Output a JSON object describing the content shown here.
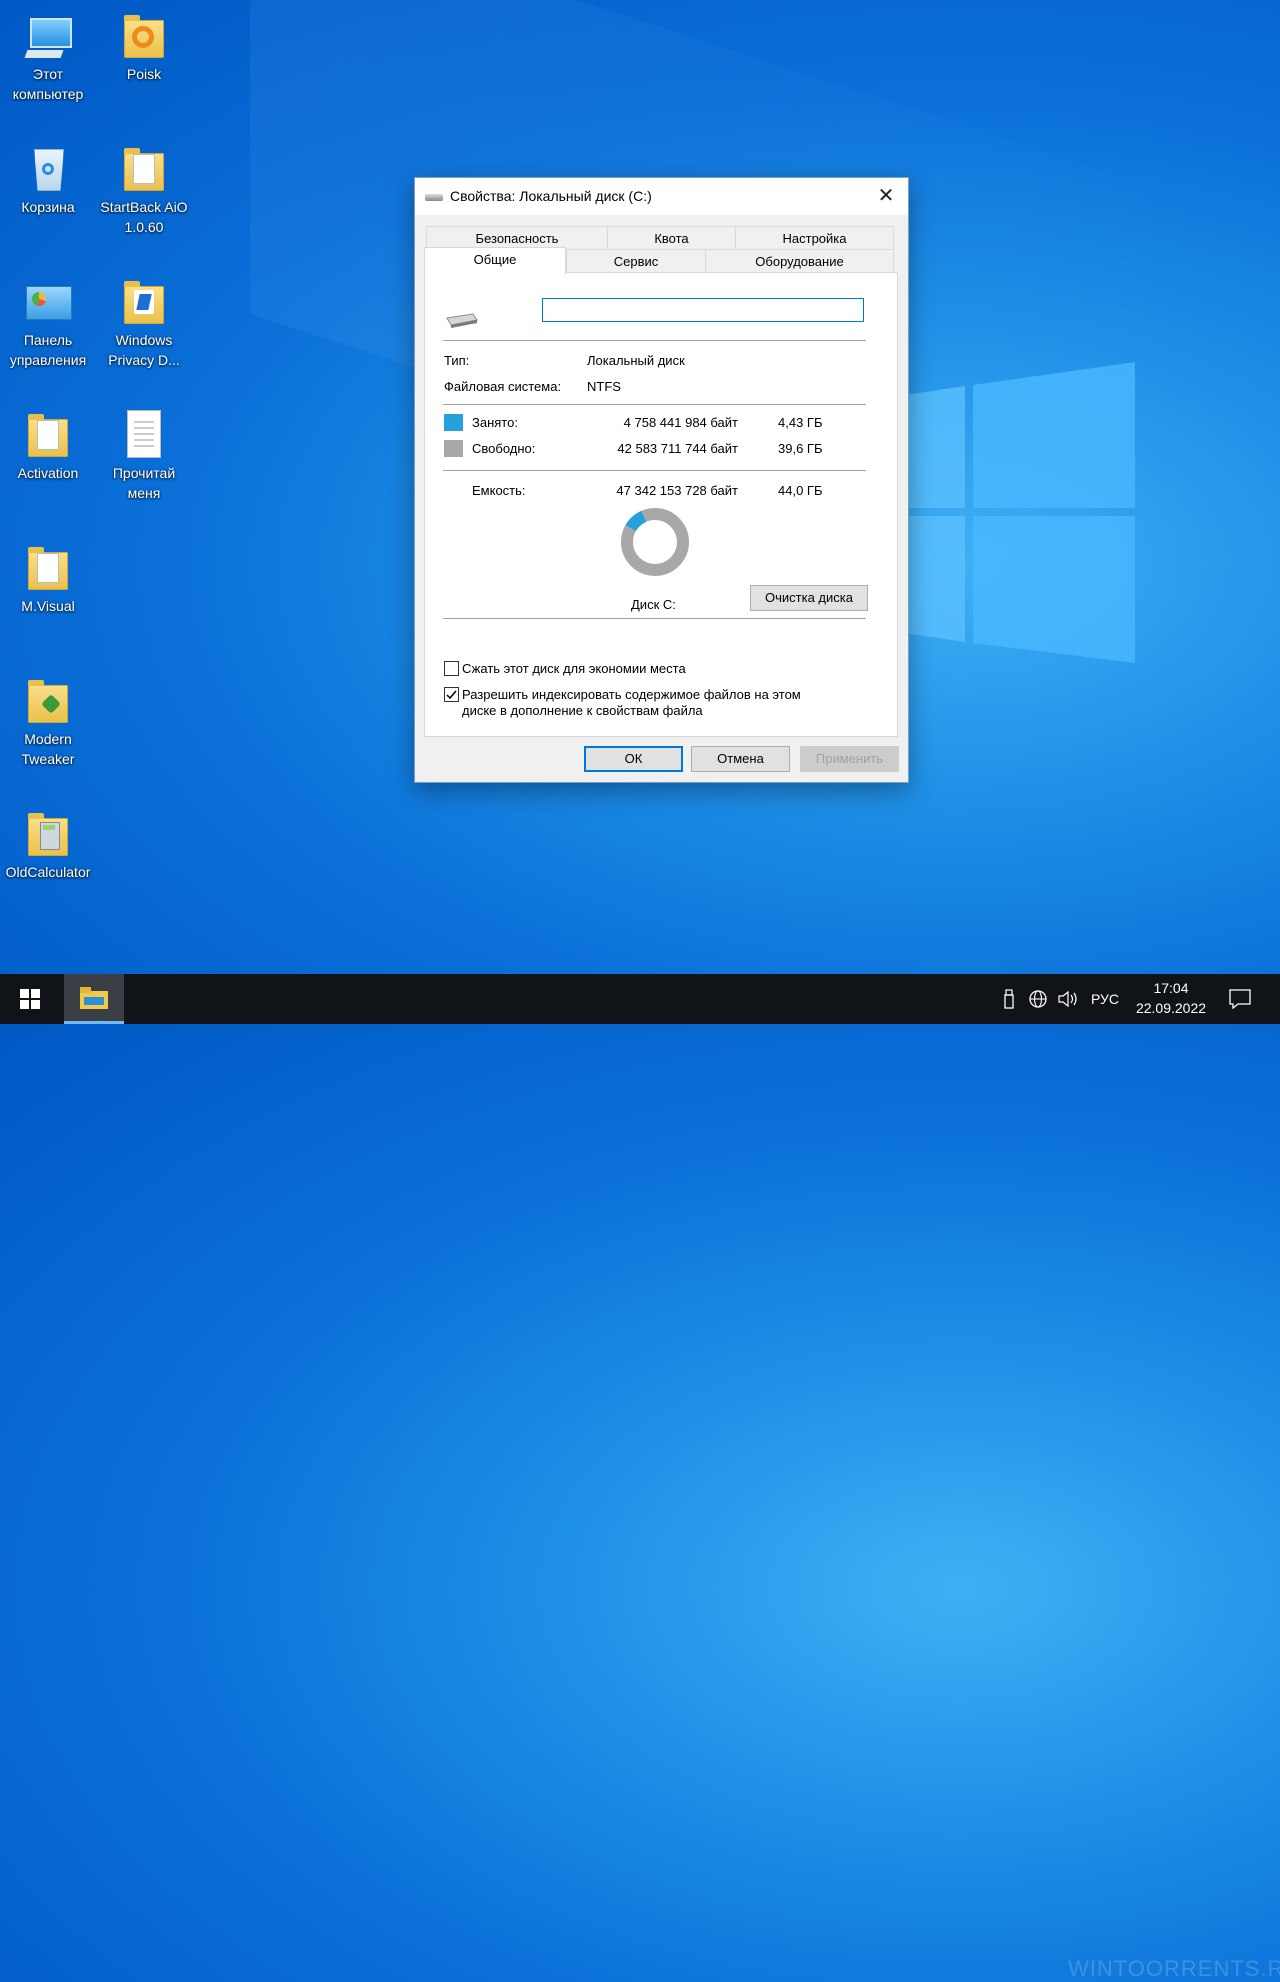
{
  "desktop": {
    "icons": [
      {
        "label": "Этот компьютер"
      },
      {
        "label": "Poisk"
      },
      {
        "label": "Корзина"
      },
      {
        "label": "StartBack AiO 1.0.60"
      },
      {
        "label": "Панель управления"
      },
      {
        "label": "Windows Privacy D..."
      },
      {
        "label": "Activation"
      },
      {
        "label": "Прочитай меня"
      },
      {
        "label": "M.Visual"
      },
      {
        "label": "Modern Tweaker"
      },
      {
        "label": "OldCalculator"
      }
    ]
  },
  "dialog": {
    "title": "Свойства: Локальный диск (C:)",
    "close_label": "✕",
    "tabs_top": [
      "Безопасность",
      "Квота",
      "Настройка"
    ],
    "tabs_bottom": [
      "Общие",
      "Сервис",
      "Оборудование"
    ],
    "active_tab": "Общие",
    "name_input_value": "",
    "type_label": "Тип:",
    "type_value": "Локальный диск",
    "fs_label": "Файловая система:",
    "fs_value": "NTFS",
    "used_label": "Занято:",
    "used_bytes": "4 758 441 984 байт",
    "used_gb": "4,43 ГБ",
    "free_label": "Свободно:",
    "free_bytes": "42 583 711 744 байт",
    "free_gb": "39,6 ГБ",
    "capacity_label": "Емкость:",
    "capacity_bytes": "47 342 153 728 байт",
    "capacity_gb": "44,0 ГБ",
    "used_fraction": 0.1005,
    "disk_caption": "Диск C:",
    "cleanup_button": "Очистка диска",
    "compress_label": "Сжать этот диск для экономии места",
    "compress_checked": false,
    "index_label_1": "Разрешить индексировать содержимое файлов на этом",
    "index_label_2": "диске в дополнение к свойствам файла",
    "index_checked": true,
    "ok_button": "ОК",
    "cancel_button": "Отмена",
    "apply_button": "Применить",
    "colors": {
      "used": "#26a0da",
      "free": "#a8a8a8"
    }
  },
  "taskbar": {
    "language": "РУС",
    "time": "17:04",
    "date": "22.09.2022"
  },
  "watermark": "WINTOORRENTS.RU"
}
